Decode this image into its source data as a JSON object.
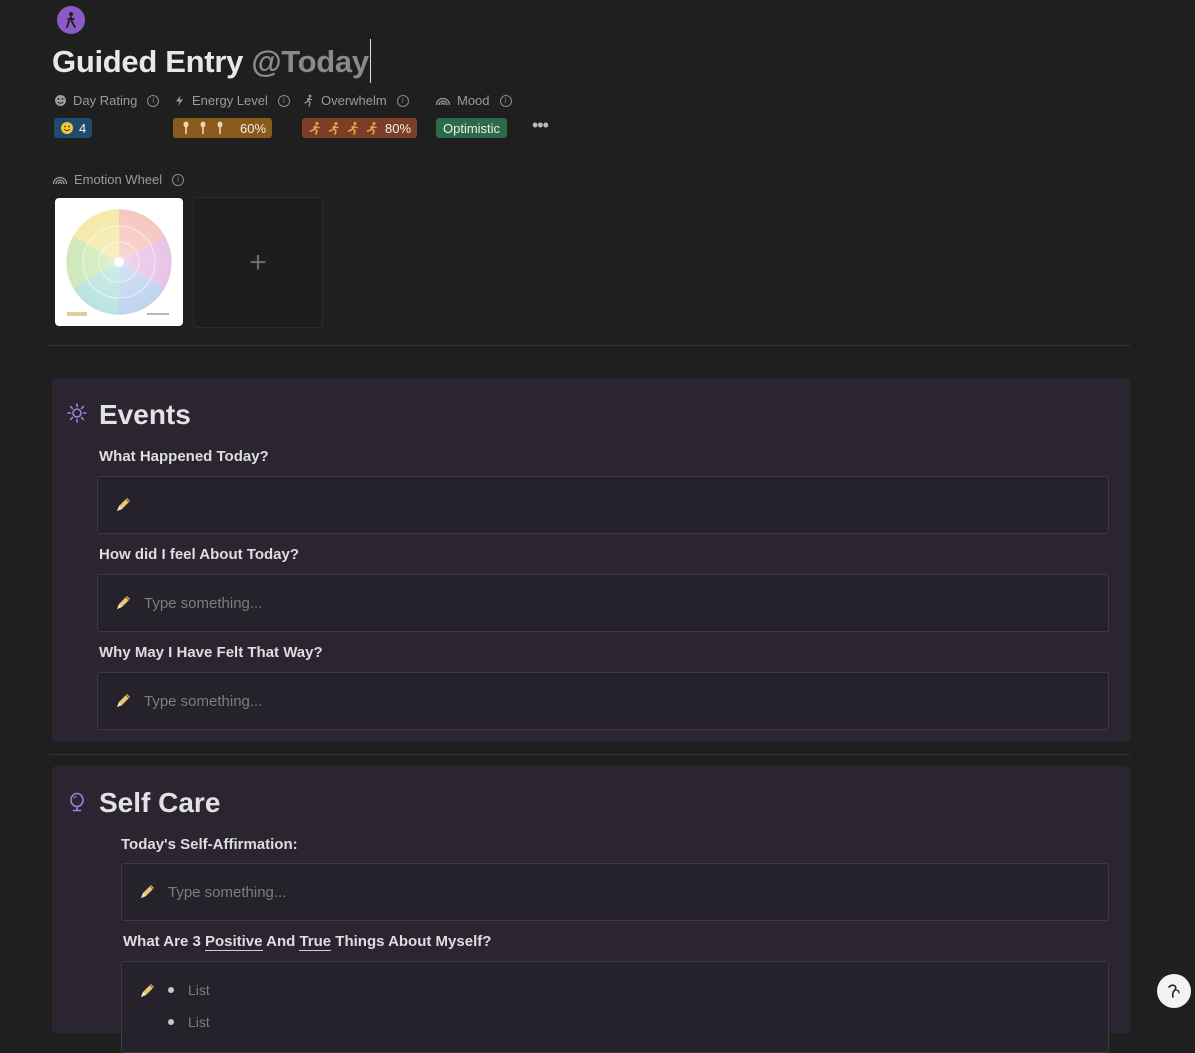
{
  "page": {
    "title": "Guided Entry",
    "title_mention": "@Today"
  },
  "properties": {
    "day_rating": {
      "label": "Day Rating",
      "value": "4"
    },
    "energy_level": {
      "label": "Energy Level",
      "value": "60%",
      "level": 0.6
    },
    "overwhelm": {
      "label": "Overwhelm",
      "value": "80%",
      "level": 0.8
    },
    "mood": {
      "label": "Mood",
      "value": "Optimistic"
    },
    "more": "•••",
    "colors": {
      "day_rating": "#1f4a6b",
      "energy": "#8a5a1c",
      "overwhelm": "#7a3f26",
      "mood": "#2d6a4a"
    }
  },
  "emotion_wheel": {
    "label": "Emotion Wheel",
    "add_symbol": "+"
  },
  "events": {
    "title": "Events",
    "icon": "sun-icon",
    "questions": [
      {
        "label": "What Happened Today?",
        "placeholder": ""
      },
      {
        "label": "How did I feel About Today?",
        "placeholder": "Type something..."
      },
      {
        "label": "Why May I Have Felt That Way?",
        "placeholder": "Type something..."
      }
    ]
  },
  "self_care": {
    "title": "Self Care",
    "icon": "mirror-icon",
    "affirmation": {
      "label": "Today's Self-Affirmation:",
      "placeholder": "Type something..."
    },
    "positives": {
      "label_pre": "What Are 3 ",
      "label_positive": "Positive",
      "label_and": " And ",
      "label_true": "True",
      "label_post": " Things About Myself?",
      "items": [
        "List",
        "List"
      ]
    }
  },
  "help_button": "?"
}
